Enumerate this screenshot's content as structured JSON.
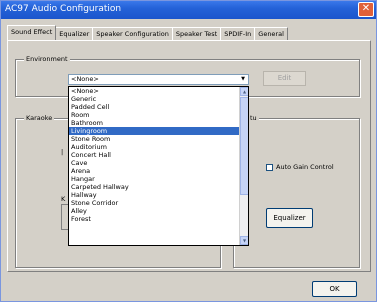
{
  "window": {
    "title": "AC97 Audio Configuration",
    "colors": {
      "titlebar": "#2462d8",
      "face": "#d4d0c8",
      "selection": "#316ac5"
    }
  },
  "tabs": [
    {
      "label": "Sound Effect",
      "active": true
    },
    {
      "label": "Equalizer",
      "active": false
    },
    {
      "label": "Speaker Configuration",
      "active": false
    },
    {
      "label": "Speaker Test",
      "active": false
    },
    {
      "label": "SPDIF-In",
      "active": false
    },
    {
      "label": "General",
      "active": false
    }
  ],
  "environment": {
    "group_label": "Environment",
    "selected_value": "<None>",
    "edit_button": "Edit",
    "options": [
      "<None>",
      "Generic",
      "Padded Cell",
      "Room",
      "Bathroom",
      "Livingroom",
      "Stone Room",
      "Auditorium",
      "Concert Hall",
      "Cave",
      "Arena",
      "Hangar",
      "Carpeted Hallway",
      "Hallway",
      "Stone Corridor",
      "Alley",
      "Forest"
    ],
    "highlighted_option": "Livingroom"
  },
  "karaoke": {
    "group_label": "Karaoke",
    "k_label": "K"
  },
  "right_group": {
    "label_fragment": "tu",
    "autogain_label": "Auto Gain Control",
    "autogain_checked": false,
    "equalizer_button": "Equalizer"
  },
  "footer": {
    "ok_button": "OK"
  }
}
